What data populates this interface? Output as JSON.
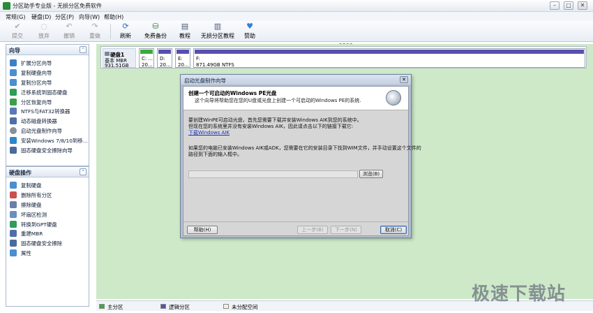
{
  "window": {
    "title": "分区助手专业版 - 无损分区免费软件"
  },
  "menu": {
    "items": [
      "常规(G)",
      "硬盘(D)",
      "分区(P)",
      "向导(W)",
      "帮助(H)"
    ]
  },
  "toolbar": {
    "items": [
      {
        "label": "提交",
        "icon": "check-icon",
        "enabled": false
      },
      {
        "label": "放弃",
        "icon": "discard-icon",
        "enabled": false
      },
      {
        "label": "撤销",
        "icon": "undo-icon",
        "enabled": false
      },
      {
        "label": "重做",
        "icon": "redo-icon",
        "enabled": false
      },
      {
        "label": "刷新",
        "icon": "refresh-icon",
        "enabled": true
      },
      {
        "label": "免费备份",
        "icon": "backup-icon",
        "enabled": true
      },
      {
        "label": "教程",
        "icon": "tutorial-icon",
        "enabled": true
      },
      {
        "label": "无损分区教程",
        "icon": "partition-tutorial-icon",
        "enabled": true
      },
      {
        "label": "赞助",
        "icon": "heart-icon",
        "enabled": true
      }
    ]
  },
  "sidebar": {
    "wizard_panel": {
      "title": "向导",
      "items": [
        "扩展分区向导",
        "复制硬盘向导",
        "复制分区向导",
        "迁移系统到固态硬盘",
        "分区恢复向导",
        "NTFS与FAT32转换器",
        "动态磁盘转换器",
        "启动光盘制作向导",
        "安装Windows 7/8/10到移...",
        "固态硬盘安全擦除向导"
      ]
    },
    "disk_panel": {
      "title": "硬盘操作",
      "items": [
        "复制硬盘",
        "删除所有分区",
        "擦除硬盘",
        "坏扇区检测",
        "转换到GPT硬盘",
        "重建MBR",
        "固态硬盘安全擦除",
        "属性"
      ]
    }
  },
  "disk": {
    "name": "硬盘1",
    "type": "基本 MBR",
    "size": "931.51GB",
    "partitions": [
      {
        "label": "C: ...",
        "info": "20...",
        "bar_color": "#3caa3c"
      },
      {
        "label": "D:",
        "info": "20...",
        "bar_color": "#5a4fb0"
      },
      {
        "label": "E:",
        "info": "20...",
        "bar_color": "#5a4fb0"
      },
      {
        "label": "F:",
        "info": "871.49GB NTFS",
        "bar_color": "#5a4fb0"
      }
    ]
  },
  "legend": {
    "items": [
      {
        "label": "主分区",
        "color": "#3caa3c"
      },
      {
        "label": "逻辑分区",
        "color": "#5a4fb0"
      },
      {
        "label": "未分配空间",
        "color": "#f5f0e6"
      }
    ]
  },
  "dialog": {
    "title": "启动光盘制作向导",
    "header_title": "创建一个可启动的Windows PE光盘",
    "header_subtitle": "这个向导将帮助您在您的U盘或光盘上创建一个可启动的Windows PE的系统.",
    "para1_line1": "要创建WinPE可启动光盘，首先您需要下载并安装Windows AIK到您的系统中。",
    "para1_line2": "但现在您的系统里并没有安装Windows AIK，因此请点击以下的链接下载它:",
    "download_link": "下载Windows AIK",
    "para2_line1": "如果您的电脑已安装Windows AIK或ADK，您需要在它的安装目录下找到WIM文件，并手动设置这个文件的",
    "para2_line2": "路径到下面的输入框中。",
    "path_value": "",
    "browse_label": "浏览(B)",
    "help_label": "帮助(H)",
    "prev_label": "上一步(B)",
    "next_label": "下一步(N)",
    "cancel_label": "取消(C)"
  },
  "watermark": "极速下载站"
}
